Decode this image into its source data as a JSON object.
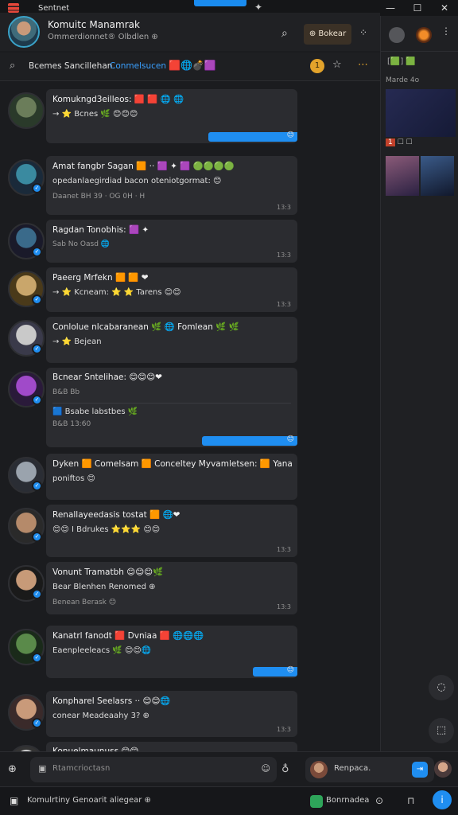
{
  "titlebar": {
    "title": "Sentnet",
    "pin_icon": "pin-icon",
    "controls": [
      "—",
      "☐",
      "✕"
    ]
  },
  "header": {
    "name": "Komuitc Manamrak",
    "subtitle": "Ommerdionnet® Olbdlen ⊕",
    "action_label": "⊕ Bokear",
    "search_icon": "search-icon",
    "more_icon": "grid-icon"
  },
  "filterbar": {
    "text": "Bcemes Sancillehan",
    "link": "Conmelsucen",
    "emojis": "🟥🌐💣🟪",
    "coin": "1",
    "accent": "#e3a32b"
  },
  "messages": [
    {
      "line1": "Komukngd3eilleos: 🟥 🟥 🌐 🌐",
      "line2": "→ ⭐ Bcnes 🌿 😊😊😊",
      "line3": "",
      "timestamp": "✓✓",
      "sent_bubble": true,
      "avatar_colors": [
        "#6b7d5a",
        "#2a3a2a"
      ]
    },
    {
      "line1": "Amat fangbr Sagan 🟧 ·· 🟪 ✦ 🟪 🟢🟢🟢🟢",
      "line2": "opedanlaegirdiad bacon oteniotgormat: 😊",
      "line3": "Daanet BH 39 · OG 0H · H",
      "timestamp": "13:3",
      "sent_bubble": false,
      "avatar_colors": [
        "#3a8aa0",
        "#1a2a3a"
      ]
    },
    {
      "line1": "Ragdan Tonobhis: 🟪 ✦",
      "line2": "",
      "line3": "Sab No Oasd 🌐",
      "timestamp": "13:3",
      "sent_bubble": false,
      "avatar_colors": [
        "#3a6a8a",
        "#1a1a2a"
      ]
    },
    {
      "line1": "Paeerg Mrfekn 🟧 🟧 ❤",
      "line2": "→ ⭐ Kcneam: ⭐ ⭐ Tarens 😊😊",
      "line3": "",
      "timestamp": "13:3",
      "sent_bubble": false,
      "avatar_colors": [
        "#c9a66b",
        "#4a3a1a"
      ]
    },
    {
      "line1": "Conlolue nlcabaranean 🌿 🌐 Fomlean 🌿 🌿",
      "line2": "→ ⭐ Bejean",
      "line3": "",
      "timestamp": "",
      "sent_bubble": false,
      "avatar_colors": [
        "#c9c9c9",
        "#3a3a4a"
      ]
    },
    {
      "line1": "Bcnear Sntelihae: 😊😊😊❤",
      "line2": "",
      "line3": "B&B Bb",
      "extra": "🟦 Bsabe labstbes 🌿",
      "extra2": "B&B 13:60",
      "timestamp": "",
      "sent_bubble": true,
      "avatar_colors": [
        "#a04ac9",
        "#2a1a3a"
      ]
    },
    {
      "line1": "Dyken 🟧 Comelsam 🟧 Conceltey Myvamletsen: 🟧 Yana",
      "line2": "poniftos 😊",
      "line3": "",
      "timestamp": "",
      "sent_bubble": false,
      "avatar_colors": [
        "#9aa3ad",
        "#2a2d34"
      ]
    },
    {
      "line1": "Renallayeedasis tostat 🟧 🌐❤",
      "line2": "😊😊 I Bdrukes ⭐⭐⭐ 😊😊",
      "line3": "",
      "timestamp": "13:3",
      "sent_bubble": false,
      "avatar_colors": [
        "#b58a6a",
        "#2a2a2a"
      ]
    },
    {
      "line1": "Vonunt Tramatbh 😊😊😊🌿",
      "line2": "Bear Blenhen Renomed ⊕",
      "line3": "Benean Berask 😊",
      "timestamp": "13:3",
      "sent_bubble": false,
      "avatar_colors": [
        "#c79a78",
        "#1a1a1a"
      ]
    },
    {
      "line1": "Kanatrl fanodt 🟥 Dvniaa 🟥 🌐🌐🌐",
      "line2": "Eaenpleeleacs 🌿 😊😊🌐",
      "line3": "",
      "timestamp": "✓✓",
      "sent_bubble": true,
      "avatar_colors": [
        "#5a8a4a",
        "#1a2a1a"
      ]
    },
    {
      "line1": "Konpharel Seelasrs ·· 😊😊🌐",
      "line2": "conear Meadeaahy 3? ⊕",
      "line3": "",
      "timestamp": "13:3",
      "sent_bubble": false,
      "avatar_colors": [
        "#c99a7a",
        "#3a2a2a"
      ]
    },
    {
      "line1": "Konuelmaunuss 😊😊",
      "line2": "",
      "line3": "",
      "timestamp": "",
      "sent_bubble": false,
      "avatar_colors": [
        "#d0d0d0",
        "#333333"
      ]
    }
  ],
  "sidebar": {
    "row1": "[🟩] 🟩",
    "label": "Marde 4o",
    "tag": "1",
    "tag_text": "☐ ☐"
  },
  "composer": {
    "placeholder": "Rtamcrioctasn",
    "reply_label": "Renpaca.",
    "send_label": "⇥"
  },
  "statusbar": {
    "text": "Komulrtiny Genoarit aliegear ⊕",
    "app_label": "Bonrnadea",
    "info": "i"
  },
  "colors": {
    "accent": "#1f8ef1",
    "background": "#1b1c1f",
    "card": "#2b2c30"
  }
}
